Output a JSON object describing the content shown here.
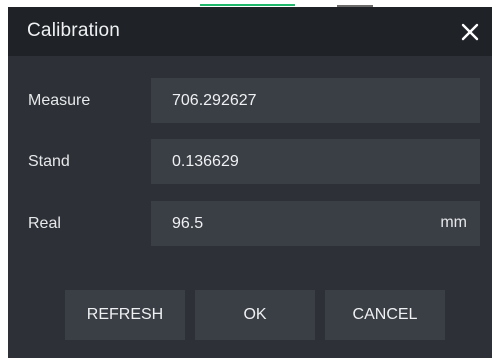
{
  "dialog": {
    "title": "Calibration",
    "close_icon": "close-icon"
  },
  "fields": {
    "measure": {
      "label": "Measure",
      "value": "706.292627"
    },
    "stand": {
      "label": "Stand",
      "value": "0.136629"
    },
    "real": {
      "label": "Real",
      "value": "96.5",
      "unit": "mm"
    }
  },
  "buttons": {
    "refresh": "REFRESH",
    "ok": "OK",
    "cancel": "CANCEL"
  },
  "colors": {
    "titlebar": "#1f2226",
    "body": "#2d3036",
    "field": "#3a3e45",
    "text": "#eef0f2",
    "accent": "#1fb86a"
  }
}
